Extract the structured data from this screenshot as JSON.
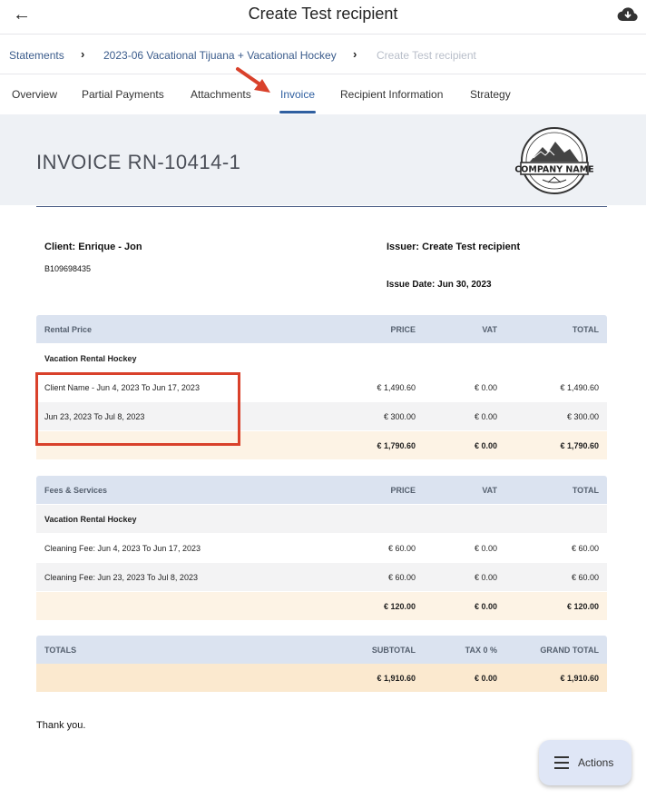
{
  "header": {
    "title": "Create Test recipient",
    "back_icon": "arrow-left-icon",
    "download_icon": "cloud-download-icon"
  },
  "breadcrumb": {
    "items": [
      "Statements",
      "2023-06 Vacational Tijuana + Vacational Hockey",
      "Create Test recipient"
    ]
  },
  "tabs": [
    "Overview",
    "Partial Payments",
    "Attachments",
    "Invoice",
    "Recipient Information",
    "Strategy"
  ],
  "active_tab": "Invoice",
  "invoice": {
    "title": "INVOICE RN-10414-1",
    "logo_text": "COMPANY NAME",
    "client": "Client: Enrique - Jon",
    "client_id": "B109698435",
    "issuer": "Issuer: Create Test recipient",
    "issue_date": "Issue Date: Jun 30, 2023",
    "rental": {
      "header": [
        "Rental Price",
        "PRICE",
        "VAT",
        "TOTAL"
      ],
      "group": "Vacation Rental Hockey",
      "rows": [
        [
          "Client Name - Jun 4, 2023 To Jun 17, 2023",
          "€ 1,490.60",
          "€ 0.00",
          "€ 1,490.60"
        ],
        [
          "Jun 23, 2023 To Jul 8, 2023",
          "€ 300.00",
          "€ 0.00",
          "€ 300.00"
        ]
      ],
      "total": [
        "",
        "€ 1,790.60",
        "€ 0.00",
        "€ 1,790.60"
      ]
    },
    "fees": {
      "header": [
        "Fees & Services",
        "PRICE",
        "VAT",
        "TOTAL"
      ],
      "group": "Vacation Rental Hockey",
      "rows": [
        [
          "Cleaning Fee: Jun 4, 2023 To Jun 17, 2023",
          "€ 60.00",
          "€ 0.00",
          "€ 60.00"
        ],
        [
          "Cleaning Fee: Jun 23, 2023 To Jul 8, 2023",
          "€ 60.00",
          "€ 0.00",
          "€ 60.00"
        ]
      ],
      "total": [
        "",
        "€ 120.00",
        "€ 0.00",
        "€ 120.00"
      ]
    },
    "totals": {
      "header": [
        "TOTALS",
        "SUBTOTAL",
        "TAX 0 %",
        "GRAND TOTAL"
      ],
      "values": [
        "",
        "€ 1,910.60",
        "€ 0.00",
        "€ 1,910.60"
      ]
    },
    "thanks": "Thank you."
  },
  "actions_button": {
    "label": "Actions",
    "icon": "menu-icon"
  },
  "colors": {
    "accent": "#2f5fa0",
    "annotation": "#d9412b",
    "header_band": "#eef1f5",
    "table_header": "#dbe3f0",
    "sum_row": "#fdf3e5"
  }
}
